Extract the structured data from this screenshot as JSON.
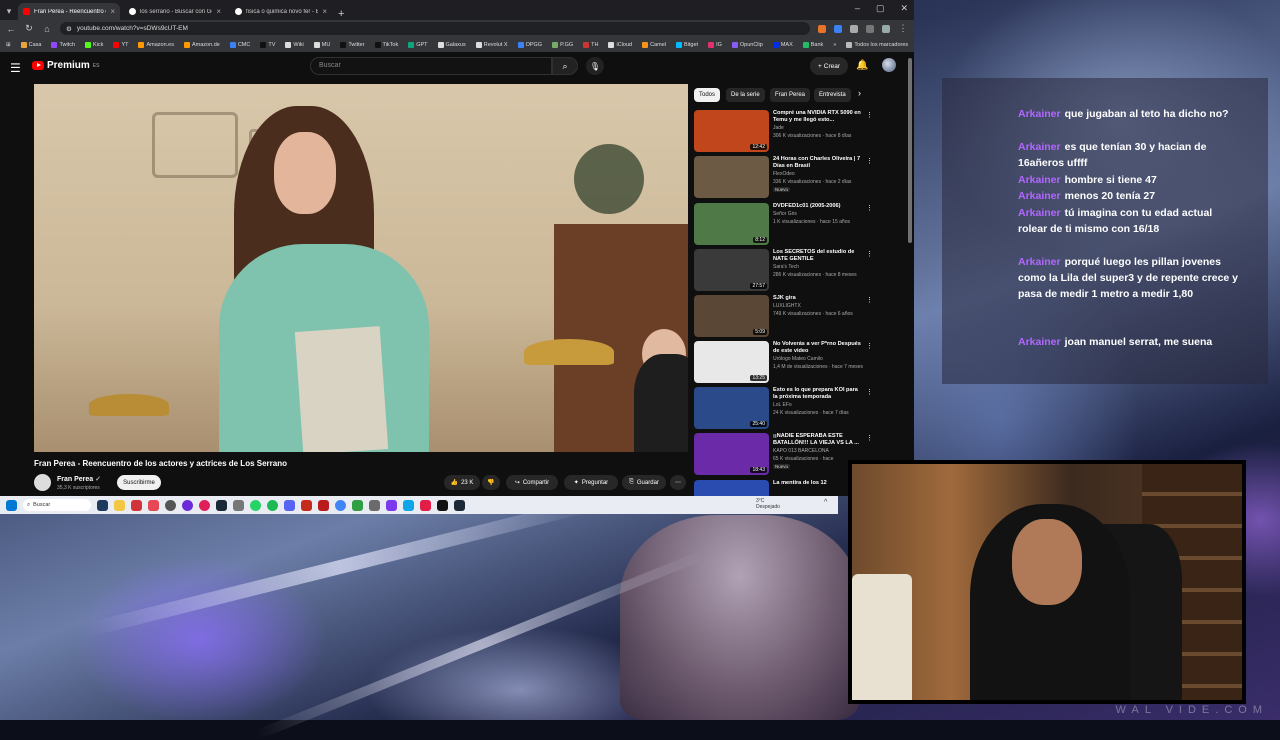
{
  "browser": {
    "tabs": [
      {
        "label": "Fran Perea - Reencuentro d",
        "color": "#ff0000",
        "active": true
      },
      {
        "label": "los serrano - Buscar con Googl",
        "color": "#ffffff",
        "active": false
      },
      {
        "label": "fisica o quimica novo fer - Bus",
        "color": "#ffffff",
        "active": false
      }
    ],
    "new_tab": "+",
    "url": "youtube.com/watch?v=sDWs9cUT-EM",
    "bookmarks": [
      "Casa",
      "Twitch",
      "Kick",
      "YT",
      "Amazon.es",
      "Amazon.de",
      "CMC",
      "TV",
      "Wiki",
      "MU",
      "Twitter",
      "TikTok",
      "GPT",
      "Galaxus",
      "Revolut X",
      "OPGG",
      "P.GG",
      "TH",
      "iCloud",
      "Camel",
      "Bitget",
      "IG",
      "OpunClip",
      "MAX",
      "Bank"
    ],
    "bookmarks_folder": "Todos los marcadores"
  },
  "youtube": {
    "logo": "Premium",
    "logo_sup": "ES",
    "search_placeholder": "Buscar",
    "create_label": "Crear",
    "video_title": "Fran Perea - Reencuentro de los actores y actrices de Los Serrano",
    "channel_name": "Fran Perea",
    "channel_subs": "35,3 K suscriptores",
    "subscribe_label": "Suscribirme",
    "likes": "23 K",
    "share_label": "Compartir",
    "ask_label": "Preguntar",
    "save_label": "Guardar",
    "chips": [
      "Todos",
      "De la serie",
      "Fran Perea",
      "Entrevista"
    ],
    "recommendations": [
      {
        "title": "Compré una NVIDIA RTX 5090 en Temu y me llegó esto...",
        "channel": "Jade",
        "meta": "306 K visualizaciones · hace 8 días",
        "duration": "12:42",
        "badge": "",
        "color": "#c2461b"
      },
      {
        "title": "24 Horas con Charles Oliveira | 7 Días en Brasil",
        "channel": "FlexOdeo",
        "meta": "336 K visualizaciones · hace 2 días",
        "duration": "",
        "badge": "Nuevo",
        "color": "#6d5a44"
      },
      {
        "title": "DVDFED1c01 (2005-2006)",
        "channel": "Señor Gris",
        "meta": "1 K visualizaciones · hace 15 años",
        "duration": "8:12",
        "badge": "",
        "color": "#4f7a47"
      },
      {
        "title": "Los SECRETOS del estudio de NATE GENTILE",
        "channel": "Sara's Tech",
        "meta": "286 K visualizaciones · hace 8 meses",
        "duration": "27:57",
        "badge": "",
        "color": "#3a3a3a"
      },
      {
        "title": "SJK gira",
        "channel": "LUXLIGHTX",
        "meta": "749 K visualizaciones · hace 6 años",
        "duration": "5:09",
        "badge": "",
        "color": "#5a4736"
      },
      {
        "title": "No Volverás a ver P*rno Después de este video",
        "channel": "Urólogo Mateo Camilo",
        "meta": "1,4 M de visualizaciones · hace 7 meses",
        "duration": "13:25",
        "badge": "",
        "color": "#e8e8e8"
      },
      {
        "title": "Esto es lo que prepara KOI para la próxima temporada",
        "channel": "LoL EFo",
        "meta": "24 K visualizaciones · hace 7 días",
        "duration": "25:40",
        "badge": "",
        "color": "#2b4a8a"
      },
      {
        "title": "¡¡NADIE ESPERABA ESTE BATALLÓN!!! LA VIEJA VS LA ...",
        "channel": "KAPO 013 BARCELONA",
        "meta": "65 K visualizaciones · hace",
        "duration": "18:43",
        "badge": "Nuevo",
        "color": "#6b2aa8"
      },
      {
        "title": "La mentira de los 12",
        "channel": "",
        "meta": "",
        "duration": "",
        "badge": "",
        "color": "#2a4bb0"
      }
    ]
  },
  "taskbar": {
    "search_label": "Buscar",
    "weather_temp": "3°C",
    "weather_desc": "Despejado"
  },
  "chat": [
    {
      "user": "Arkainer",
      "message": "que jugaban al teto ha dicho no?"
    },
    {
      "user": "Arkainer",
      "message": "es que tenían 30 y hacian de 16añeros uffff"
    },
    {
      "user": "Arkainer",
      "message": "hombre si tiene 47"
    },
    {
      "user": "Arkainer",
      "message": "menos 20 tenía 27"
    },
    {
      "user": "Arkainer",
      "message": "tú imagina con tu edad actual rolear de ti mismo con 16/18"
    },
    {
      "user": "Arkainer",
      "message": "porqué luego les pillan jovenes como la Lila del super3 y de repente crece y pasa de medir 1 metro a medir 1,80"
    },
    {
      "user": "Arkainer",
      "message": "joan manuel serrat, me suena"
    }
  ],
  "watermark": "WAL VIDE.COM"
}
